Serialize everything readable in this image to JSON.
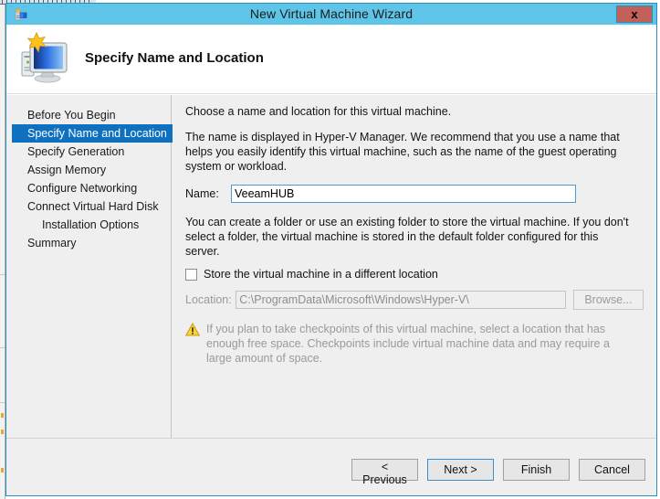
{
  "window": {
    "title": "New Virtual Machine Wizard",
    "title_icon": "vm-wizard-icon",
    "close_label": "x",
    "accent_color": "#5fc5e8",
    "close_button_color": "#c4605a"
  },
  "header": {
    "icon": "computer-monitor-icon",
    "title": "Specify Name and Location"
  },
  "sidebar": {
    "selected_color": "#1070c0",
    "items": [
      {
        "label": "Before You Begin",
        "selected": false,
        "sub": false
      },
      {
        "label": "Specify Name and Location",
        "selected": true,
        "sub": false
      },
      {
        "label": "Specify Generation",
        "selected": false,
        "sub": false
      },
      {
        "label": "Assign Memory",
        "selected": false,
        "sub": false
      },
      {
        "label": "Configure Networking",
        "selected": false,
        "sub": false
      },
      {
        "label": "Connect Virtual Hard Disk",
        "selected": false,
        "sub": false
      },
      {
        "label": "Installation Options",
        "selected": false,
        "sub": true
      },
      {
        "label": "Summary",
        "selected": false,
        "sub": false
      }
    ]
  },
  "content": {
    "intro": "Choose a name and location for this virtual machine.",
    "description": "The name is displayed in Hyper-V Manager. We recommend that you use a name that helps you easily identify this virtual machine, such as the name of the guest operating system or workload.",
    "name_label": "Name:",
    "name_value": "VeeamHUB",
    "name_placeholder": "",
    "folder_description": "You can create a folder or use an existing folder to store the virtual machine. If you don't select a folder, the virtual machine is stored in the default folder configured for this server.",
    "store_checkbox_label": "Store the virtual machine in a different location",
    "store_checkbox_checked": false,
    "location_label": "Location:",
    "location_value": "C:\\ProgramData\\Microsoft\\Windows\\Hyper-V\\",
    "browse_label": "Browse...",
    "warning_icon": "warning-triangle-icon",
    "warning_text": "If you plan to take checkpoints of this virtual machine, select a location that has enough free space. Checkpoints include virtual machine data and may require a large amount of space."
  },
  "footer": {
    "previous_label": "< Previous",
    "next_label": "Next >",
    "finish_label": "Finish",
    "cancel_label": "Cancel",
    "default_button": "Next >"
  }
}
